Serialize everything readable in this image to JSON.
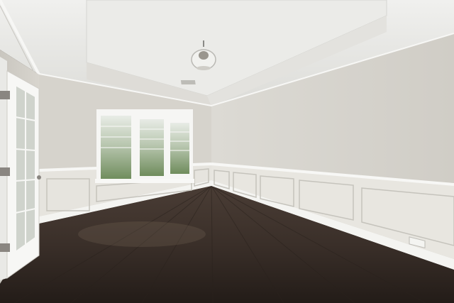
{
  "scene": {
    "kind": "empty-room-interior",
    "features": [
      "tray-ceiling",
      "crown-molding",
      "flush-mount-ceiling-light",
      "ceiling-air-vent",
      "triple-window",
      "wainscoting-panels",
      "french-door",
      "dark-hardwood-floor"
    ]
  },
  "colors": {
    "wall": "#d9d6cf",
    "wall_shadow": "#c7c4bd",
    "ceiling": "#e9e9e6",
    "trim": "#f4f4f1",
    "floor": "#3a2f29",
    "floor_dark": "#2a221d",
    "window_glass": "#7f9a72"
  }
}
